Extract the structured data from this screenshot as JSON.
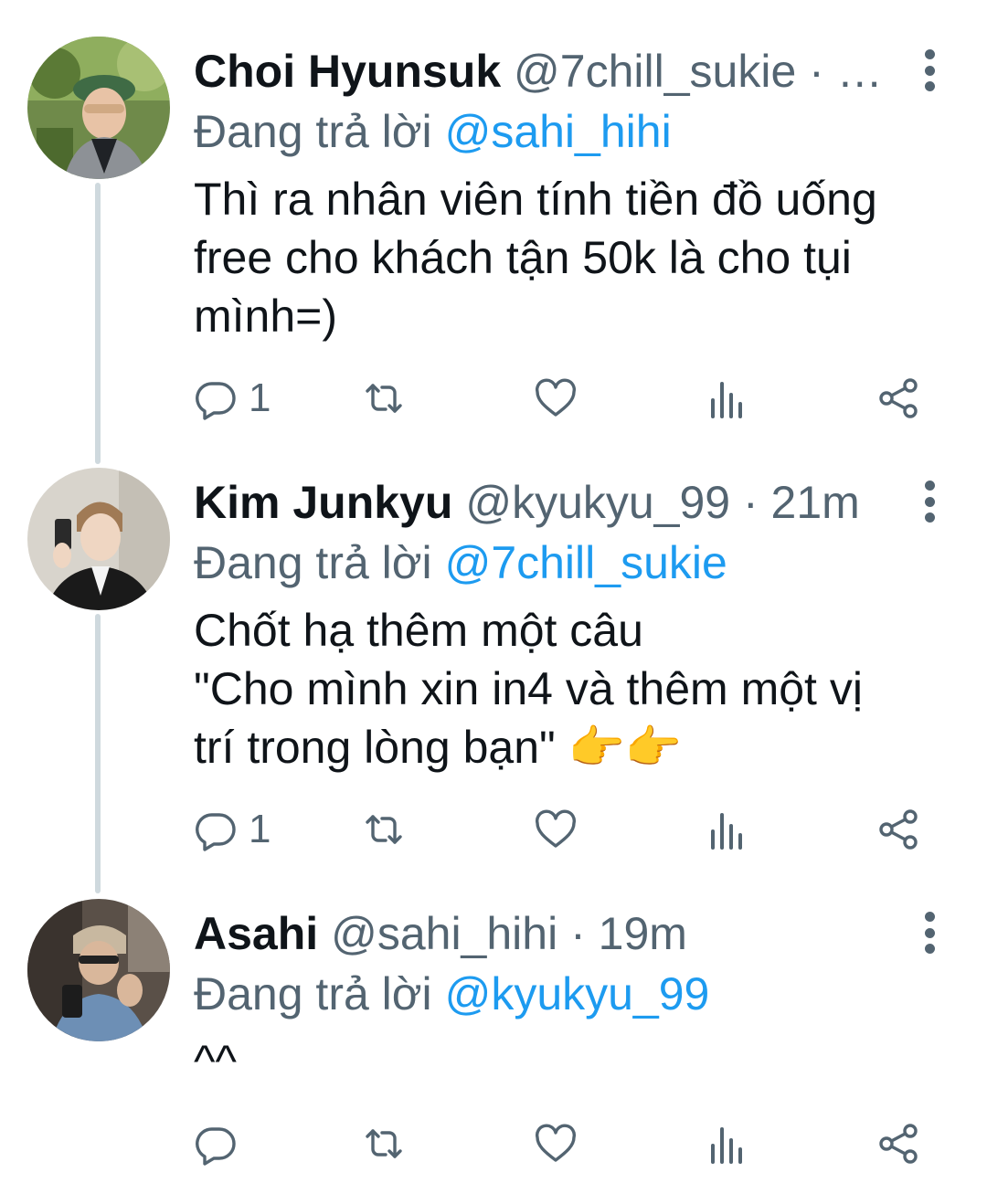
{
  "tweets": [
    {
      "name": "Choi Hyunsuk",
      "handle": "@7chill_sukie",
      "separator": " · ",
      "time": "…",
      "reply_prefix": "Đang trả lời ",
      "reply_to": "@sahi_hihi",
      "text": "Thì ra nhân viên tính tiền đồ uống\nfree cho khách tận 50k là cho tụi\nmình=)",
      "reply_count": "1",
      "avatar": "avatar-green-beret"
    },
    {
      "name": "Kim Junkyu",
      "handle": "@kyukyu_99",
      "separator": " · ",
      "time": "21m",
      "reply_prefix": "Đang trả lời ",
      "reply_to": "@7chill_sukie",
      "text": "Chốt hạ thêm một câu\n\"Cho mình xin in4 và thêm một vị\ntrí trong lòng bạn\" 👉👉",
      "reply_count": "1",
      "avatar": "avatar-mirror-selfie"
    },
    {
      "name": "Asahi",
      "handle": "@sahi_hihi",
      "separator": " · ",
      "time": "19m",
      "reply_prefix": "Đang trả lời ",
      "reply_to": "@kyukyu_99",
      "text": "^^",
      "reply_count": "",
      "avatar": "avatar-dark-selfie"
    }
  ],
  "colors": {
    "text": "#0f1419",
    "secondary": "#536471",
    "link": "#1d9bf0",
    "thread_line": "#cfd9de"
  },
  "icons": {
    "reply": "comment-icon",
    "retweet": "retweet-icon",
    "like": "heart-icon",
    "views": "bar-chart-icon",
    "share": "share-icon",
    "more": "more-vertical-icon"
  }
}
